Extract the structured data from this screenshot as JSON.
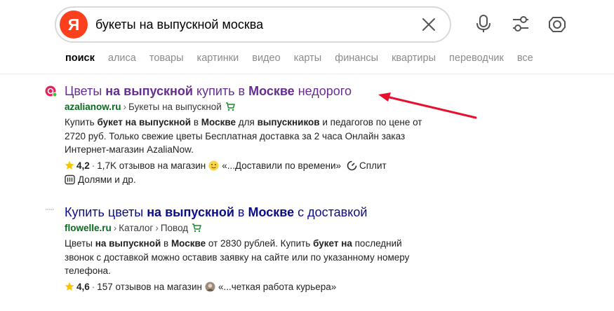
{
  "search": {
    "logo_letter": "Я",
    "query": "букеты на выпускной москва"
  },
  "tabs": [
    {
      "label": "поиск",
      "active": true
    },
    {
      "label": "алиса"
    },
    {
      "label": "товары"
    },
    {
      "label": "картинки"
    },
    {
      "label": "видео"
    },
    {
      "label": "карты"
    },
    {
      "label": "финансы"
    },
    {
      "label": "квартиры"
    },
    {
      "label": "переводчик"
    },
    {
      "label": "все"
    }
  ],
  "results": [
    {
      "title_parts": [
        "Цветы ",
        "на выпускной",
        " купить в ",
        "Москве",
        " недорого"
      ],
      "domain": "azalianow.ru",
      "crumbs": [
        "Букеты на выпускной"
      ],
      "snippet_lines": [
        [
          "Купить ",
          "букет на выпускной",
          " в ",
          "Москве",
          " для ",
          "выпускников",
          " и педагогов по цене от"
        ],
        [
          "2720 руб. Только свежие цветы Бесплатная доставка за 2 часа Онлайн заказ"
        ],
        [
          "Интернет-магазин AzaliaNow."
        ]
      ],
      "rating": "4,2",
      "reviews": "1,7K отзывов на магазин",
      "quote": "«...Доставили по времени»",
      "split": "Сплит",
      "dolyami": "Долями и др."
    },
    {
      "title_parts": [
        "Купить цветы ",
        "на выпускной",
        " в ",
        "Москве",
        " с доставкой"
      ],
      "domain": "flowelle.ru",
      "crumbs": [
        "Каталог",
        "Повод"
      ],
      "snippet_lines": [
        [
          "Цветы ",
          "на выпускной",
          " в ",
          "Москве",
          " от 2830 рублей. Купить ",
          "букет на",
          " последний"
        ],
        [
          "звонок с доставкой можно оставив заявку на сайте или по указанному номеру"
        ],
        [
          "телефона."
        ]
      ],
      "rating": "4,6",
      "reviews": "157 отзывов на магазин",
      "quote": "«...четкая работа курьера»"
    }
  ],
  "colors": {
    "logo": "#fc3f1d",
    "visited_title": "#662e8f",
    "title": "#0c0c8a",
    "domain": "#0a6b1f",
    "arrow": "#e8112d",
    "star": "#f7c600"
  }
}
